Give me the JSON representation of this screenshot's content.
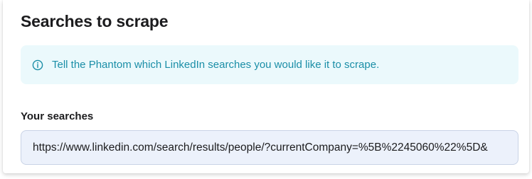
{
  "section": {
    "title": "Searches to scrape"
  },
  "info_banner": {
    "icon": "info-icon",
    "text": "Tell the Phantom which LinkedIn searches you would like it to scrape."
  },
  "searches_field": {
    "label": "Your searches",
    "value": "https://www.linkedin.com/search/results/people/?currentCompany=%5B%2245060%22%5D&",
    "placeholder": ""
  },
  "colors": {
    "banner_background": "#ebf9fc",
    "banner_text": "#1a8ea7",
    "input_background": "#ecf1fb",
    "heading_text": "#1c1c1e"
  }
}
